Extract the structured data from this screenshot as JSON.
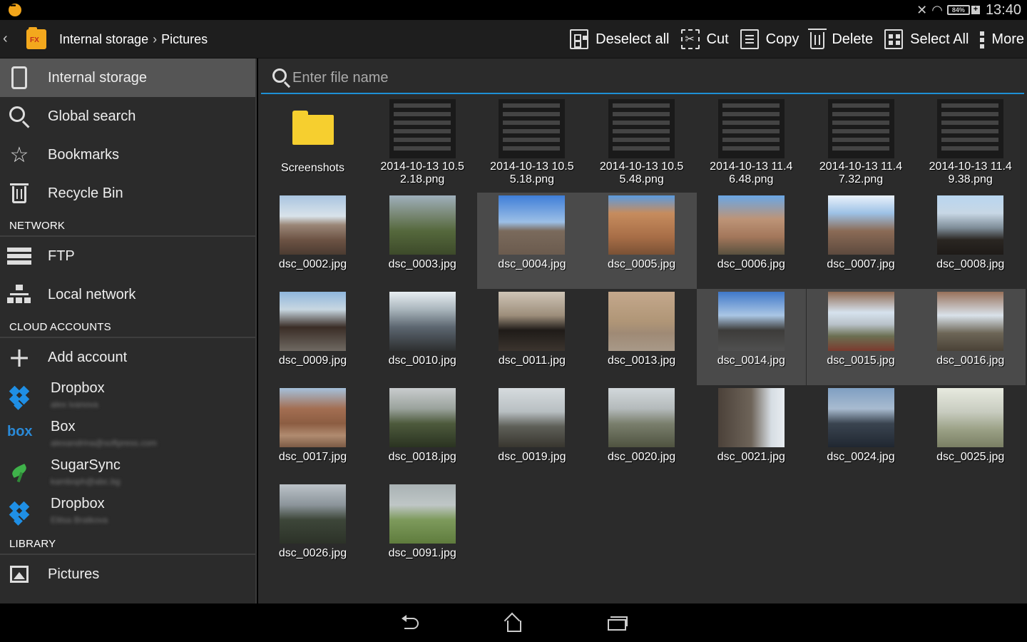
{
  "status_bar": {
    "battery": "84%",
    "time": "13:40",
    "icons": [
      "notification-icon",
      "nfc-icon",
      "wifi-icon",
      "battery-charging-icon"
    ]
  },
  "action_bar": {
    "breadcrumb": [
      "Internal storage",
      "Pictures"
    ],
    "buttons": {
      "deselect_all": "Deselect all",
      "cut": "Cut",
      "copy": "Copy",
      "delete": "Delete",
      "select_all": "Select All",
      "more": "More"
    }
  },
  "sidebar": {
    "items": [
      {
        "label": "Internal storage",
        "icon": "phone-icon"
      },
      {
        "label": "Global search",
        "icon": "search-icon"
      },
      {
        "label": "Bookmarks",
        "icon": "star-icon"
      },
      {
        "label": "Recycle Bin",
        "icon": "trash-icon"
      }
    ],
    "network_header": "NETWORK",
    "network": [
      {
        "label": "FTP",
        "icon": "ftp-icon"
      },
      {
        "label": "Local network",
        "icon": "network-icon"
      }
    ],
    "cloud_header": "CLOUD ACCOUNTS",
    "add_account": "Add account",
    "cloud": [
      {
        "label": "Dropbox",
        "sub": "alex ivanova",
        "icon": "dropbox-icon"
      },
      {
        "label": "Box",
        "sub": "alexandrina@softpress.com",
        "icon": "box-icon"
      },
      {
        "label": "SugarSync",
        "sub": "kamboph@abc.bg",
        "icon": "sugarsync-icon"
      },
      {
        "label": "Dropbox",
        "sub": "Elitsa Bratkova",
        "icon": "dropbox-icon"
      }
    ],
    "library_header": "LIBRARY",
    "library": [
      {
        "label": "Pictures",
        "icon": "pictures-icon"
      }
    ]
  },
  "search": {
    "placeholder": "Enter file name"
  },
  "files": [
    {
      "name": "Screenshots",
      "type": "folder",
      "selected": false
    },
    {
      "name": "2014-10-13 10.52.18.png",
      "type": "screenshot",
      "selected": false
    },
    {
      "name": "2014-10-13 10.55.18.png",
      "type": "screenshot",
      "selected": false
    },
    {
      "name": "2014-10-13 10.55.48.png",
      "type": "screenshot",
      "selected": false
    },
    {
      "name": "2014-10-13 11.46.48.png",
      "type": "screenshot",
      "selected": false
    },
    {
      "name": "2014-10-13 11.47.32.png",
      "type": "screenshot",
      "selected": false
    },
    {
      "name": "2014-10-13 11.49.38.png",
      "type": "screenshot",
      "selected": false
    },
    {
      "name": "dsc_0002.jpg",
      "type": "photo",
      "selected": false
    },
    {
      "name": "dsc_0003.jpg",
      "type": "photo",
      "selected": false
    },
    {
      "name": "dsc_0004.jpg",
      "type": "photo",
      "selected": true
    },
    {
      "name": "dsc_0005.jpg",
      "type": "photo",
      "selected": true
    },
    {
      "name": "dsc_0006.jpg",
      "type": "photo",
      "selected": false
    },
    {
      "name": "dsc_0007.jpg",
      "type": "photo",
      "selected": false
    },
    {
      "name": "dsc_0008.jpg",
      "type": "photo",
      "selected": false
    },
    {
      "name": "dsc_0009.jpg",
      "type": "photo",
      "selected": false
    },
    {
      "name": "dsc_0010.jpg",
      "type": "photo",
      "selected": false
    },
    {
      "name": "dsc_0011.jpg",
      "type": "photo",
      "selected": false
    },
    {
      "name": "dsc_0013.jpg",
      "type": "photo",
      "selected": false
    },
    {
      "name": "dsc_0014.jpg",
      "type": "photo",
      "selected": true
    },
    {
      "name": "dsc_0015.jpg",
      "type": "photo",
      "selected": true
    },
    {
      "name": "dsc_0016.jpg",
      "type": "photo",
      "selected": true
    },
    {
      "name": "dsc_0017.jpg",
      "type": "photo",
      "selected": false
    },
    {
      "name": "dsc_0018.jpg",
      "type": "photo",
      "selected": false
    },
    {
      "name": "dsc_0019.jpg",
      "type": "photo",
      "selected": false
    },
    {
      "name": "dsc_0020.jpg",
      "type": "photo",
      "selected": false
    },
    {
      "name": "dsc_0021.jpg",
      "type": "photo",
      "selected": false
    },
    {
      "name": "dsc_0024.jpg",
      "type": "photo",
      "selected": false
    },
    {
      "name": "dsc_0025.jpg",
      "type": "photo",
      "selected": false
    },
    {
      "name": "dsc_0026.jpg",
      "type": "photo",
      "selected": false
    },
    {
      "name": "dsc_0091.jpg",
      "type": "photo",
      "selected": false
    }
  ],
  "nav_bar": {
    "icons": [
      "back-icon",
      "home-icon",
      "recent-apps-icon"
    ]
  },
  "colors": {
    "accent": "#1e90d6",
    "folder": "#f6cf2f",
    "selection": "#4a4a4a",
    "sidebar_active": "#555555"
  }
}
